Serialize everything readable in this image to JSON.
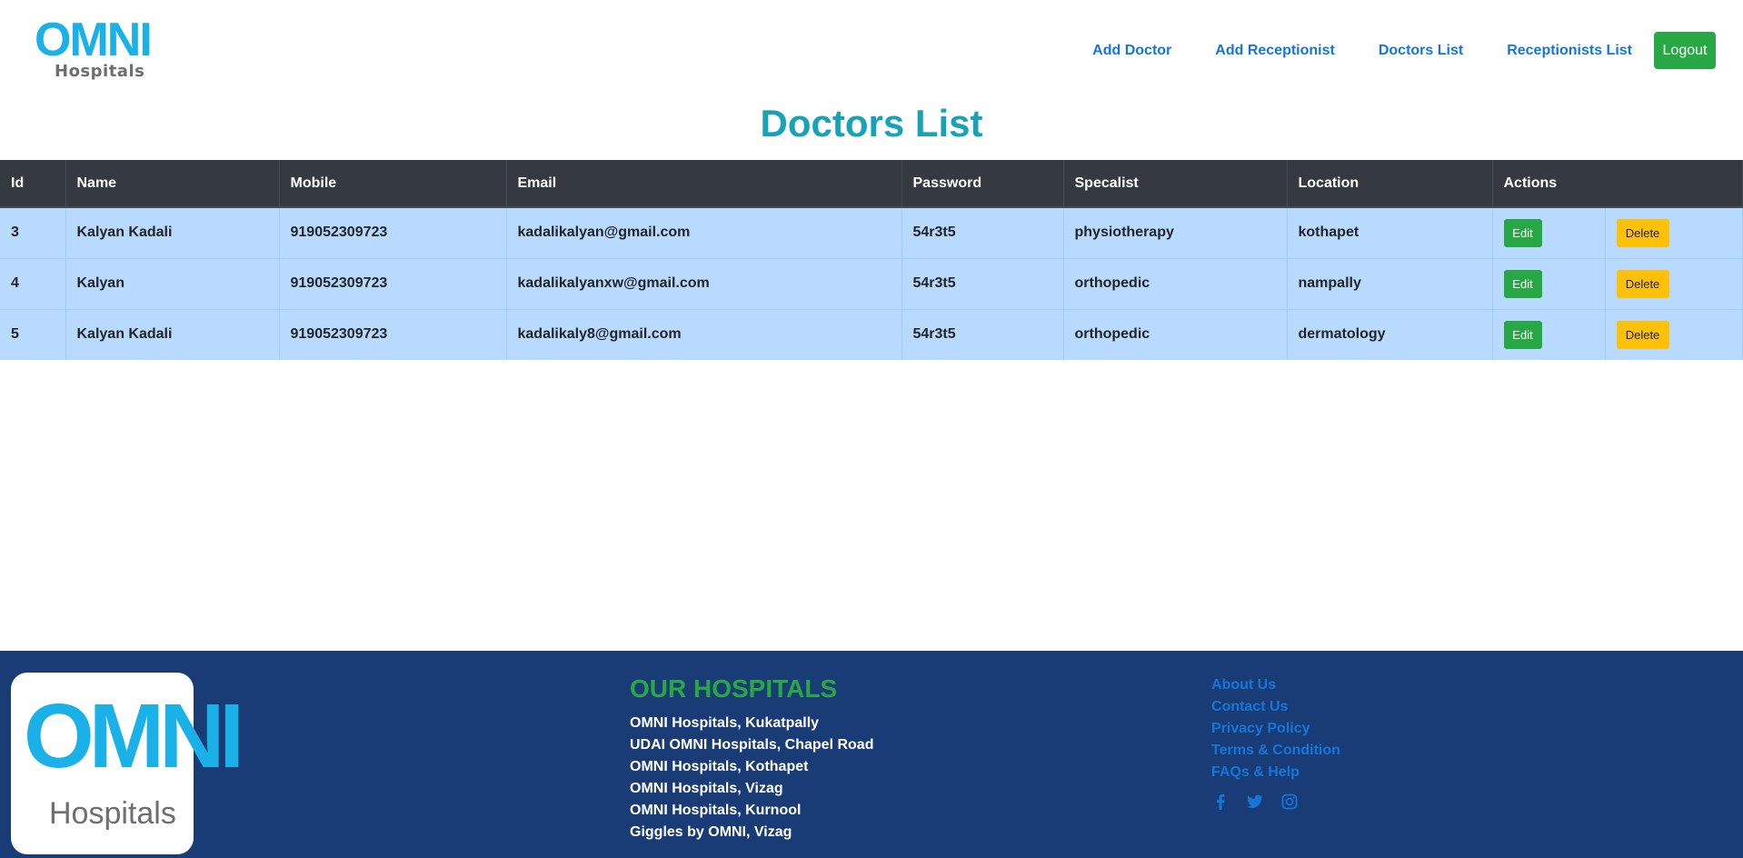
{
  "header": {
    "logo_text": "OMNI",
    "logo_sub": "Hospitals",
    "nav": [
      "Add Doctor",
      "Add Receptionist",
      "Doctors List",
      "Receptionists List"
    ],
    "logout": "Logout"
  },
  "page_title": "Doctors List",
  "table": {
    "columns": [
      "Id",
      "Name",
      "Mobile",
      "Email",
      "Password",
      "Specalist",
      "Location",
      "Actions"
    ],
    "rows": [
      {
        "id": "3",
        "name": "Kalyan Kadali",
        "mobile": "919052309723",
        "email": "kadalikalyan@gmail.com",
        "password": "54r3t5",
        "specalist": "physiotherapy",
        "location": "kothapet"
      },
      {
        "id": "4",
        "name": "Kalyan",
        "mobile": "919052309723",
        "email": "kadalikalyanxw@gmail.com",
        "password": "54r3t5",
        "specalist": "orthopedic",
        "location": "nampally"
      },
      {
        "id": "5",
        "name": "Kalyan Kadali",
        "mobile": "919052309723",
        "email": "kadalikaly8@gmail.com",
        "password": "54r3t5",
        "specalist": "orthopedic",
        "location": "dermatology"
      }
    ],
    "edit_label": "Edit",
    "delete_label": "Delete"
  },
  "footer": {
    "logo_text": "OMNI",
    "logo_sub": "Hospitals",
    "hospitals_title": "OUR HOSPITALS",
    "hospitals": [
      "OMNI Hospitals, Kukatpally",
      "UDAI OMNI Hospitals, Chapel Road",
      "OMNI Hospitals, Kothapet",
      "OMNI Hospitals, Vizag",
      "OMNI Hospitals, Kurnool",
      "Giggles by OMNI, Vizag"
    ],
    "links": [
      "About Us",
      "Contact Us",
      "Privacy Policy",
      "Terms & Condition",
      "FAQs & Help"
    ],
    "social_icons": [
      "facebook-icon",
      "twitter-icon",
      "instagram-icon"
    ]
  },
  "colors": {
    "brand_blue": "#1ab0e8",
    "title_teal": "#17a2b8",
    "link_blue": "#1476d9",
    "table_header": "#343a40",
    "row_bg": "#b8daff",
    "footer_bg": "#1a3c76",
    "success_green": "#28a745",
    "warning_yellow": "#ffc107"
  }
}
